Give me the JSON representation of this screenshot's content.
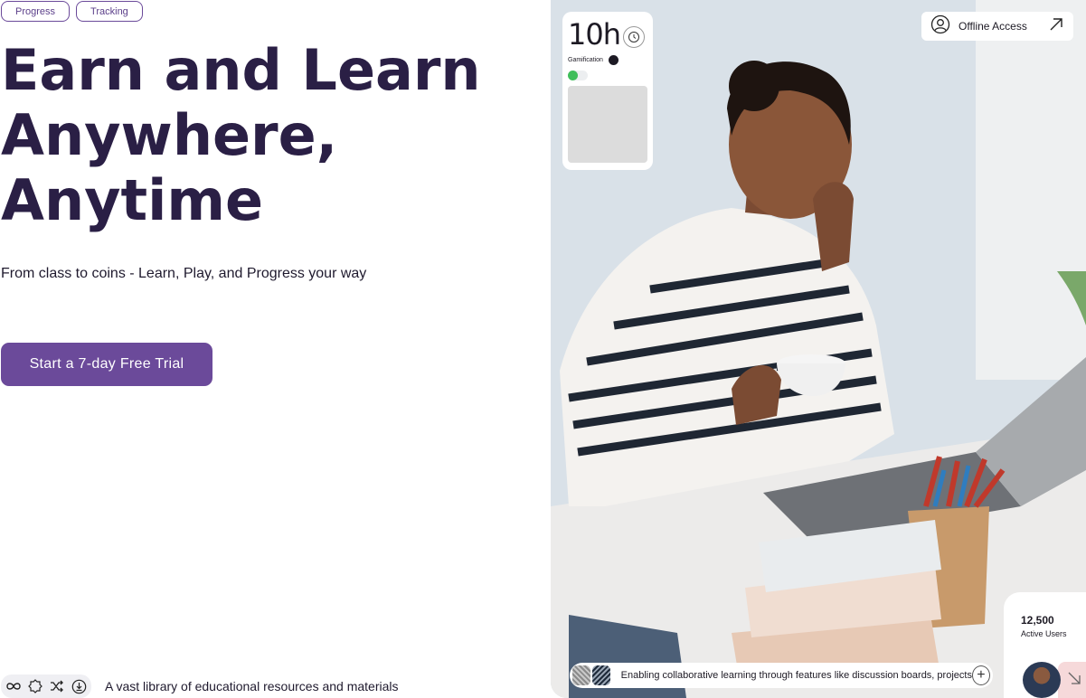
{
  "tags": [
    "Progress",
    "Tracking"
  ],
  "hero": {
    "title": "Earn and Learn\nAnywhere,\nAnytime",
    "subtitle": "From class to coins - Learn, Play, and Progress your way",
    "cta_label": "Start a 7-day Free Trial"
  },
  "features": {
    "icons": [
      "infinity-icon",
      "badge-icon",
      "shuffle-icon",
      "download-icon"
    ],
    "text": "A vast library of educational resources and materials"
  },
  "stat_card": {
    "value": "10h",
    "label": "Gamification",
    "toggle_on": true
  },
  "offline": {
    "label": "Offline Access"
  },
  "bottom_pill": {
    "text": "Enabling collaborative learning through features like discussion boards, projects"
  },
  "users": {
    "count": "12,500",
    "label": "Active Users"
  },
  "colors": {
    "brand": "#6b4a9a",
    "heading": "#2a1f45",
    "toggle_on": "#3fbe5a"
  }
}
